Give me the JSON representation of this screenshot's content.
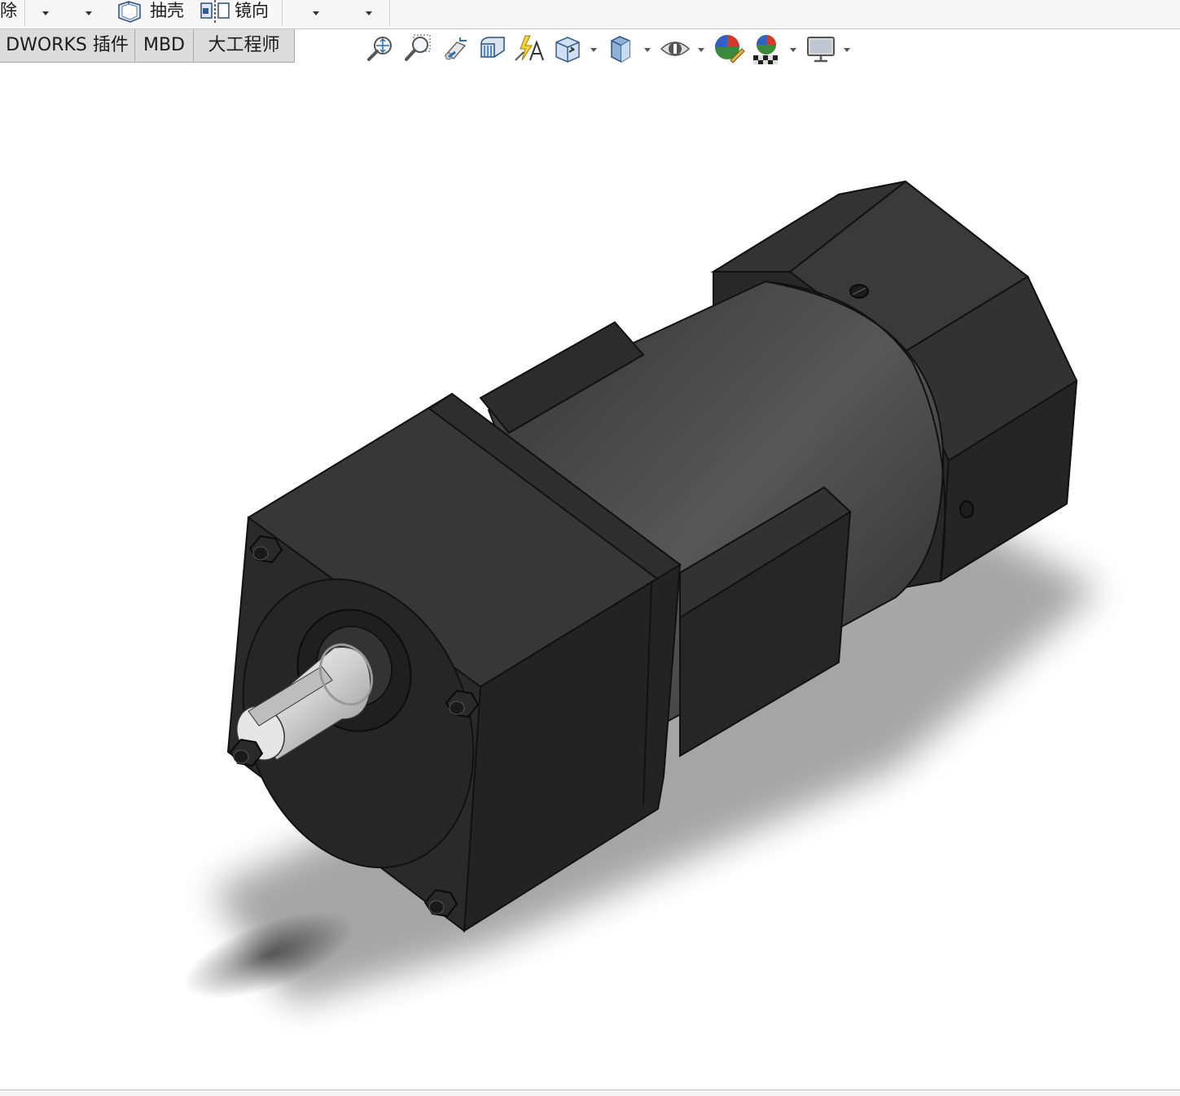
{
  "ribbon": {
    "partial_left_label": "除",
    "shell_label": "抽壳",
    "mirror_label": "镜向"
  },
  "tabs": [
    {
      "label": "DWORKS 插件"
    },
    {
      "label": "MBD"
    },
    {
      "label": "大工程师"
    }
  ],
  "heads_up_toolbar": {
    "buttons": [
      {
        "icon": "zoom-to-fit-icon"
      },
      {
        "icon": "zoom-to-area-icon"
      },
      {
        "icon": "previous-view-icon"
      },
      {
        "icon": "section-view-icon"
      },
      {
        "icon": "dynamic-annotation-views-icon"
      },
      {
        "icon": "view-orientation-icon"
      },
      {
        "icon": "display-style-icon"
      },
      {
        "icon": "hide-show-items-icon"
      },
      {
        "icon": "edit-appearance-icon"
      },
      {
        "icon": "apply-scene-icon"
      },
      {
        "icon": "view-settings-icon"
      }
    ]
  },
  "colors": {
    "ribbon_bg": "#f7f7f7",
    "tab_bg": "#dcdcdc",
    "viewport_bg": "#ffffff",
    "body_dark": "#2b2b2b",
    "body_mid": "#3a3a3a",
    "shaft": "#d9d9d9"
  }
}
